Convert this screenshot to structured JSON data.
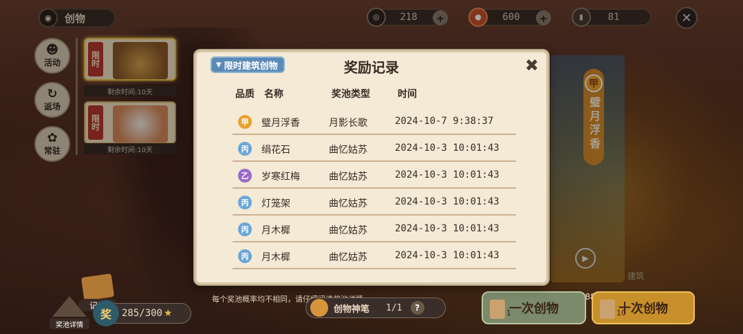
{
  "header": {
    "title": "创物",
    "currencies": [
      {
        "icon": "coin-icon",
        "value": "218"
      },
      {
        "icon": "fruit-icon",
        "value": "600"
      },
      {
        "icon": "ticket-icon",
        "value": "81"
      }
    ]
  },
  "sidenav": {
    "items": [
      {
        "label": "活动"
      },
      {
        "label": "返场"
      },
      {
        "label": "常驻"
      }
    ]
  },
  "pools": [
    {
      "tag": "限时",
      "remain": "剩余时间:10天"
    },
    {
      "tag": "限时",
      "remain": "剩余时间:10天"
    }
  ],
  "featured": {
    "badge": "甲",
    "name": "璧月浮香"
  },
  "right_hint": "建筑",
  "modal": {
    "title": "奖励记录",
    "filter_label": "限时建筑创物",
    "columns": {
      "quality": "品质",
      "name": "名称",
      "pool": "奖池类型",
      "time": "时间"
    },
    "rows": [
      {
        "quality": "甲",
        "name": "璧月浮香",
        "pool": "月影长歌",
        "time": "2024-10-7  9:38:37"
      },
      {
        "quality": "丙",
        "name": "绢花石",
        "pool": "曲忆姑苏",
        "time": "2024-10-3  10:01:43"
      },
      {
        "quality": "乙",
        "name": "岁寒红梅",
        "pool": "曲忆姑苏",
        "time": "2024-10-3  10:01:43"
      },
      {
        "quality": "丙",
        "name": "灯笼架",
        "pool": "曲忆姑苏",
        "time": "2024-10-3  10:01:43"
      },
      {
        "quality": "丙",
        "name": "月木樨",
        "pool": "曲忆姑苏",
        "time": "2024-10-3  10:01:43"
      },
      {
        "quality": "丙",
        "name": "月木樨",
        "pool": "曲忆姑苏",
        "time": "2024-10-3  10:01:43"
      }
    ]
  },
  "bottom": {
    "record_label": "记录",
    "pool_detail_label": "奖池详情",
    "progress": {
      "badge": "奖",
      "value": "285/300"
    },
    "odds_tip": "每个奖池概率均不相同，请仔细阅读奖池详情",
    "brush": {
      "label": "创物神笔",
      "count": "1/1"
    },
    "today_count": "今日创物次数:1/388",
    "one_draw": {
      "label": "一次创物",
      "cost": "1"
    },
    "ten_draw": {
      "label": "十次创物",
      "cost": "10"
    }
  }
}
